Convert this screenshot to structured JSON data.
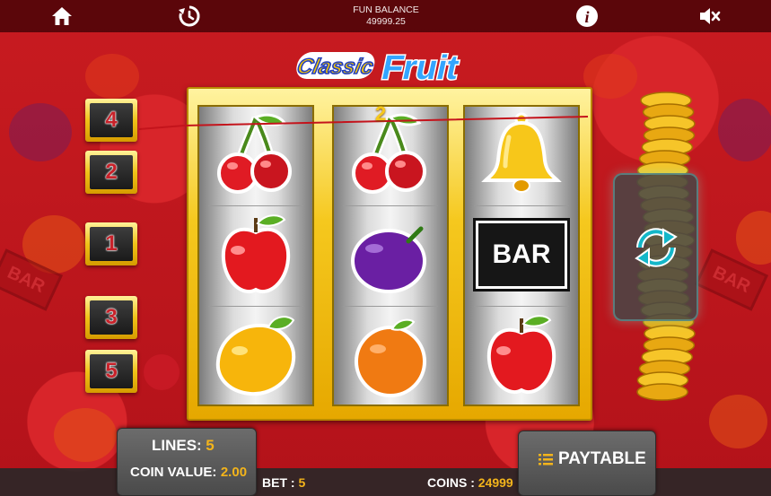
{
  "topbar": {
    "balance_label": "FUN BALANCE",
    "balance_value": "49999.25",
    "icons": [
      "home-icon",
      "history-icon",
      "info-icon",
      "mute-icon"
    ]
  },
  "logo": {
    "line1": "Classic",
    "line2": "Fruit"
  },
  "paylines": {
    "left_buttons": [
      "4",
      "2",
      "1",
      "3",
      "5"
    ],
    "win_line_number": "2"
  },
  "reels": [
    [
      "cherry",
      "apple",
      "lemon"
    ],
    [
      "cherry",
      "plum",
      "orange"
    ],
    [
      "bell",
      "bar",
      "apple"
    ]
  ],
  "bar_label": "BAR",
  "background_bar_label": "BAR",
  "controls": {
    "lines_label": "LINES:",
    "lines_value": "5",
    "coin_value_label": "COIN VALUE:",
    "coin_value": "2.00",
    "bet_label": "BET :",
    "bet_value": "5",
    "coins_label": "COINS :",
    "coins_value": "24999",
    "paytable_label": "PAYTABLE",
    "spin_icon": "spin-icon"
  },
  "colors": {
    "background": "#c0141a",
    "gold": "#f0c219",
    "value_orange": "#f3b41b",
    "button_number_red": "#c8222a"
  }
}
